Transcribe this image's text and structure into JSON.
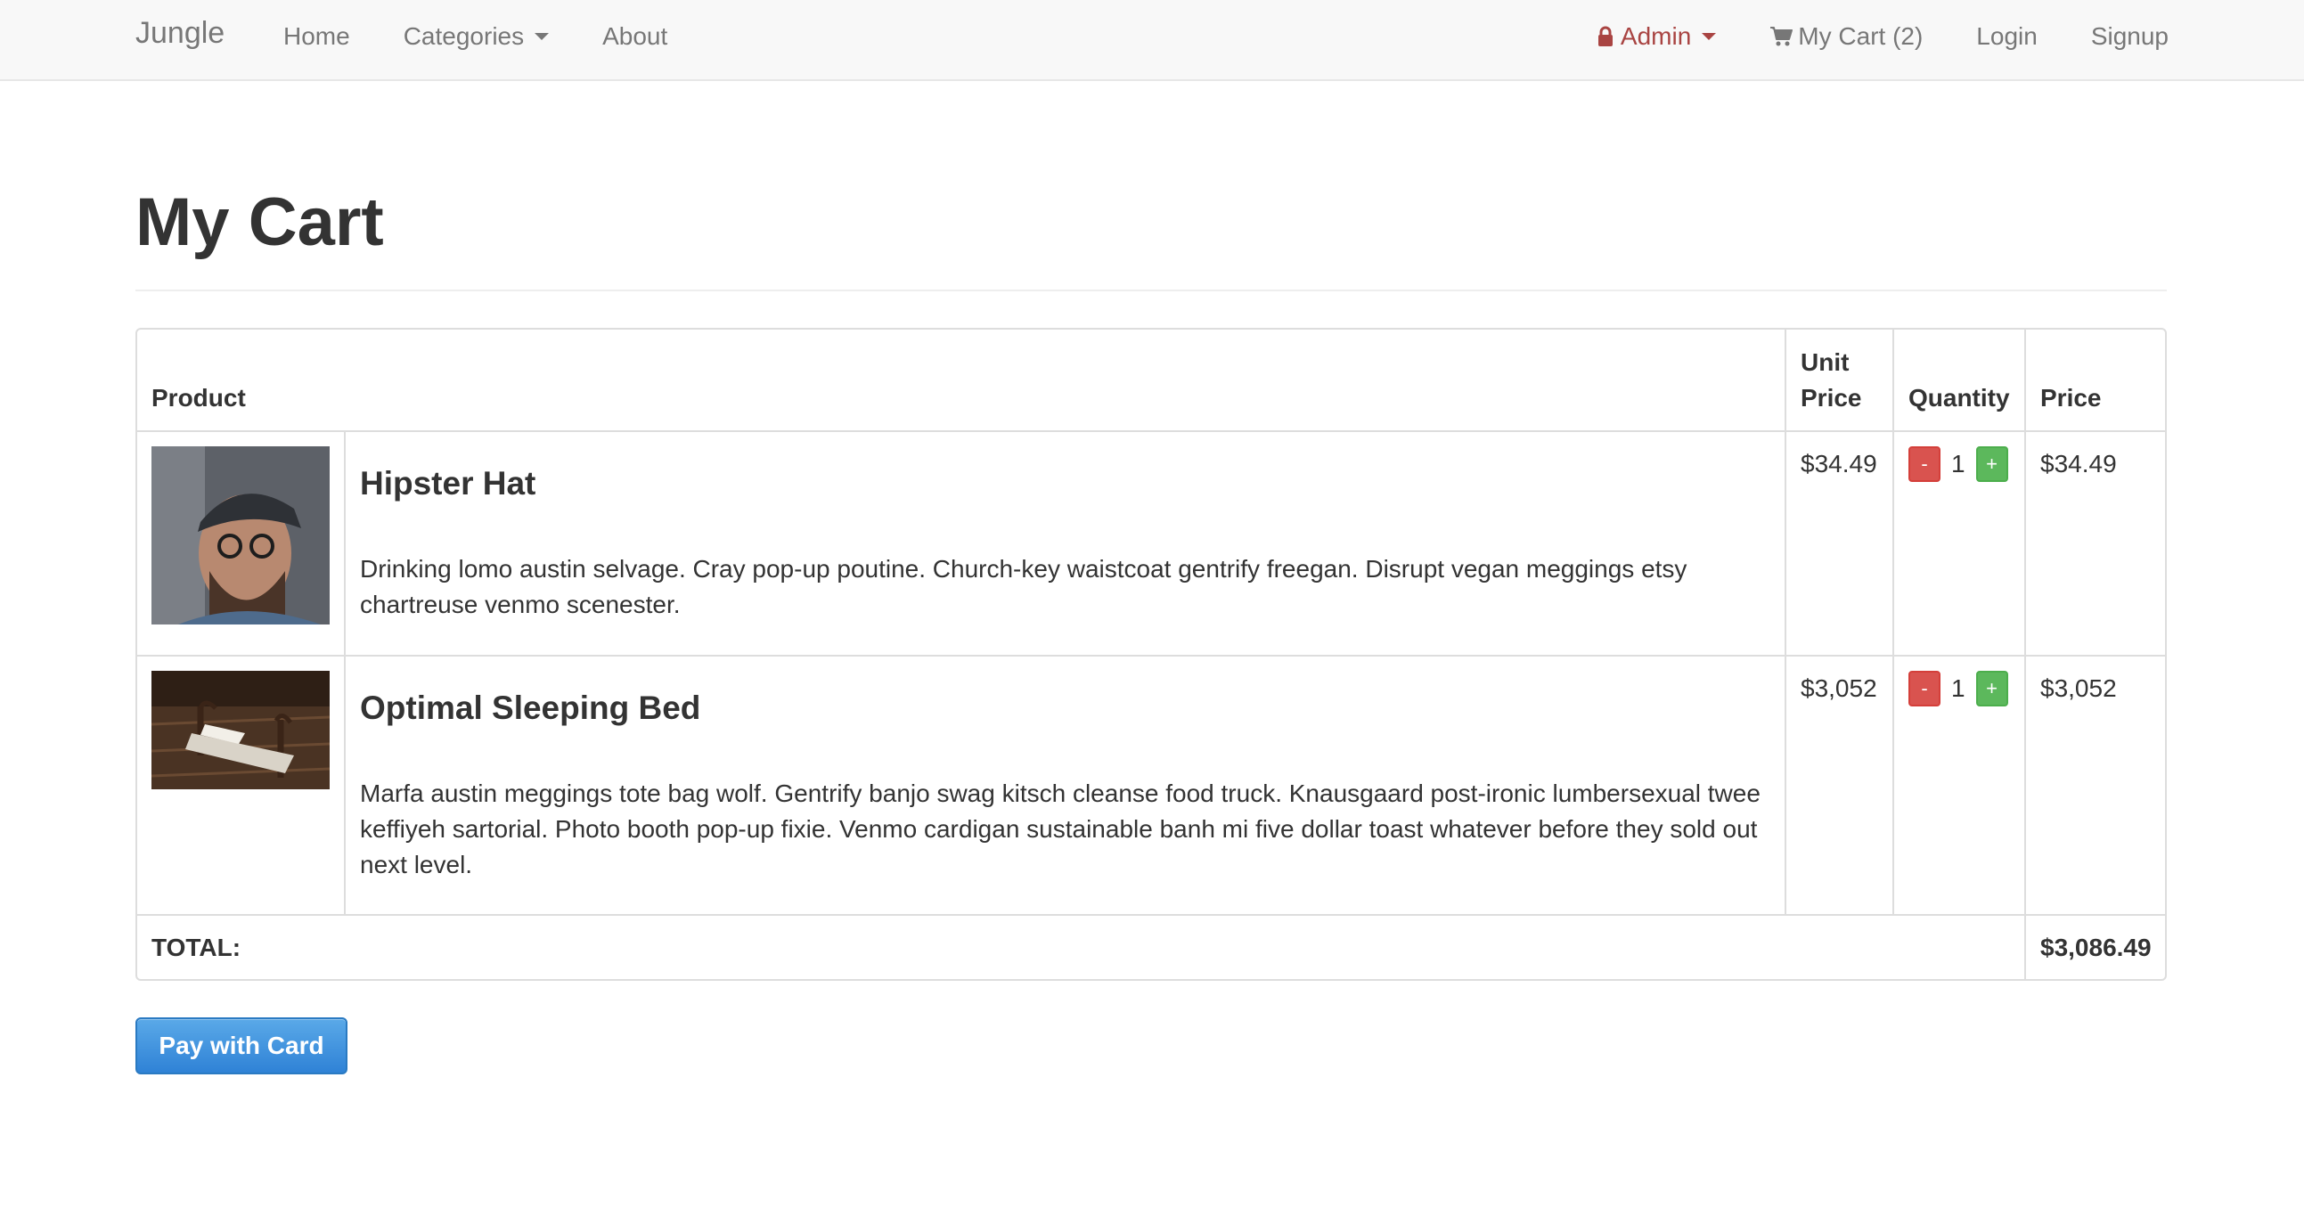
{
  "navbar": {
    "brand": "Jungle",
    "left_links": [
      "Home",
      "Categories",
      "About"
    ],
    "admin_label": "Admin",
    "cart_label": "My Cart (2)",
    "login_label": "Login",
    "signup_label": "Signup"
  },
  "page": {
    "title": "My Cart"
  },
  "cart": {
    "headers": {
      "product": "Product",
      "unit_price_line1": "Unit",
      "unit_price_line2": "Price",
      "quantity": "Quantity",
      "price": "Price"
    },
    "items": [
      {
        "name": "Hipster Hat",
        "description": "Drinking lomo austin selvage. Cray pop-up poutine. Church-key waistcoat gentrify freegan. Disrupt vegan meggings etsy chartreuse venmo scenester.",
        "unit_price": "$34.49",
        "quantity": "1",
        "price": "$34.49",
        "image_icon": "hipster-hat-photo"
      },
      {
        "name": "Optimal Sleeping Bed",
        "description": "Marfa austin meggings tote bag wolf. Gentrify banjo swag kitsch cleanse food truck. Knausgaard post-ironic lumbersexual twee keffiyeh sartorial. Photo booth pop-up fixie. Venmo cardigan sustainable banh mi five dollar toast whatever before they sold out next level.",
        "unit_price": "$3,052",
        "quantity": "1",
        "price": "$3,052",
        "image_icon": "sleeping-bed-photo"
      }
    ],
    "minus_label": "-",
    "plus_label": "+",
    "total_label": "TOTAL:",
    "total_value": "$3,086.49"
  },
  "pay_button_label": "Pay with Card",
  "colors": {
    "navbar_bg": "#f8f8f8",
    "admin": "#a94442",
    "minus": "#d9534f",
    "plus": "#5cb85c",
    "pay": "#2f82d6"
  }
}
